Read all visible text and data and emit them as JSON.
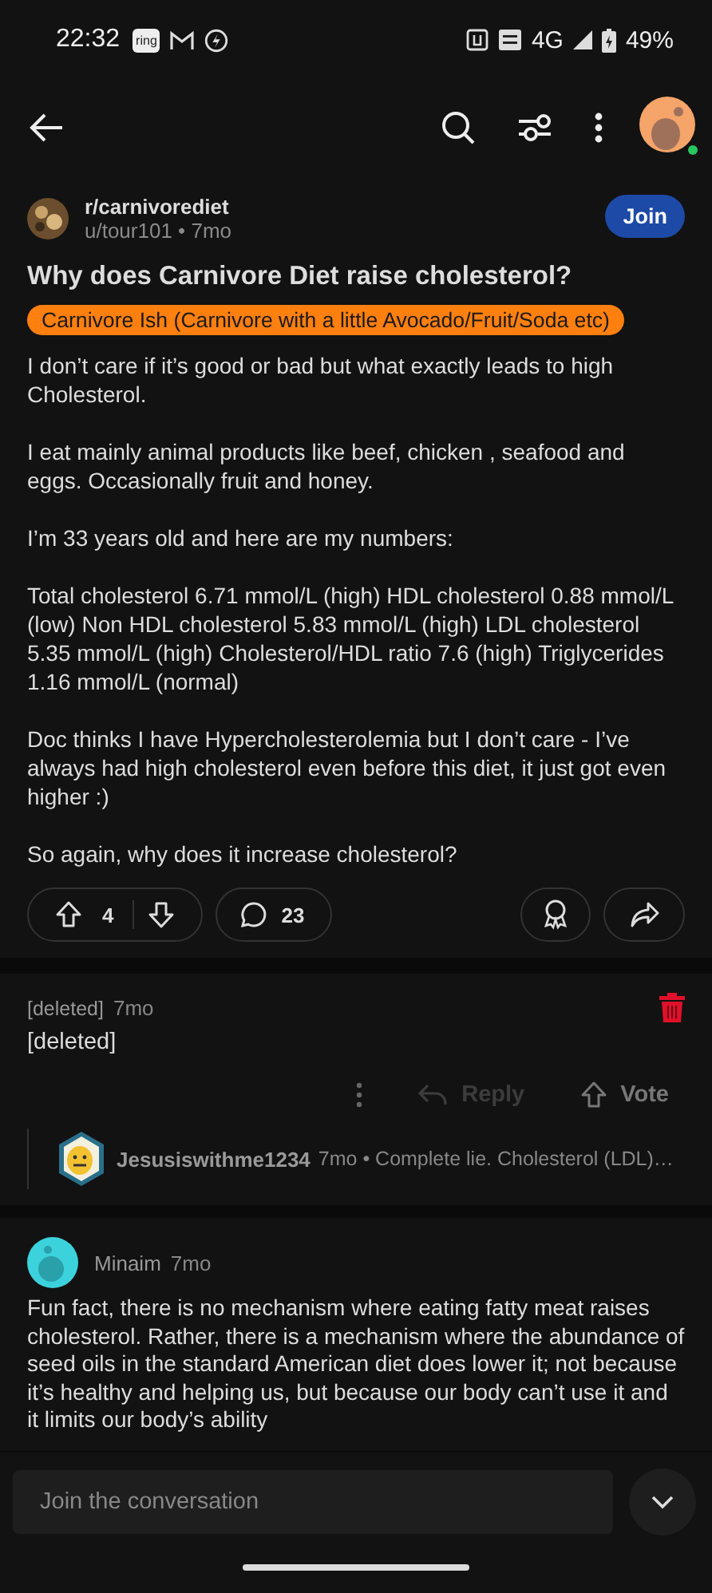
{
  "status_bar": {
    "time": "22:32",
    "notification_icons": [
      {
        "kind": "ring",
        "label": "ring"
      },
      {
        "kind": "gmail"
      },
      {
        "kind": "bolt"
      }
    ],
    "network": "4G",
    "battery": "49%"
  },
  "post": {
    "subreddit": "r/carnivorediet",
    "author": "u/tour101",
    "meta_separator": "•",
    "age": "7mo",
    "join_label": "Join",
    "title": "Why does Carnivore Diet raise cholesterol?",
    "flair": "Carnivore Ish (Carnivore with a little Avocado/Fruit/Soda etc)",
    "paragraphs": [
      "I don’t care if it’s good or bad but what exactly leads to high Cholesterol.",
      "I eat mainly animal products like beef, chicken , seafood and eggs. Occasionally fruit and honey.",
      "I’m 33 years old and here are my numbers:",
      "Total cholesterol 6.71 mmol/L (high) HDL cholesterol 0.88 mmol/L (low) Non HDL cholesterol 5.83 mmol/L (high) LDL cholesterol 5.35 mmol/L (high) Cholesterol/HDL ratio 7.6 (high) Triglycerides 1.16 mmol/L (normal)",
      "Doc thinks I have Hypercholesterolemia but I don’t care - I’ve always had high cholesterol even before this diet, it just got even higher :)",
      "So again, why does it increase cholesterol?"
    ],
    "score": "4",
    "comments": "23"
  },
  "comments": [
    {
      "kind": "deleted",
      "author": "[deleted]",
      "age": "7mo",
      "body": "[deleted]",
      "actions": [
        {
          "label": "Reply",
          "disabled": true
        },
        {
          "label": "Vote",
          "disabled": false
        }
      ],
      "reply_preview": {
        "author": "Jesusiswithme1234",
        "age": "7mo",
        "snippet": "• Complete lie. Cholesterol (LDL)…"
      }
    },
    {
      "kind": "normal",
      "author": "Minaim",
      "age": "7mo",
      "body": "Fun fact, there is no mechanism where eating fatty meat raises cholesterol. Rather, there is a mechanism where the abundance of seed oils in the standard American diet does lower it; not because it’s healthy and helping us, but because our body can’t use it and it limits our body’s ability"
    }
  ],
  "composer": {
    "placeholder": "Join the conversation"
  }
}
